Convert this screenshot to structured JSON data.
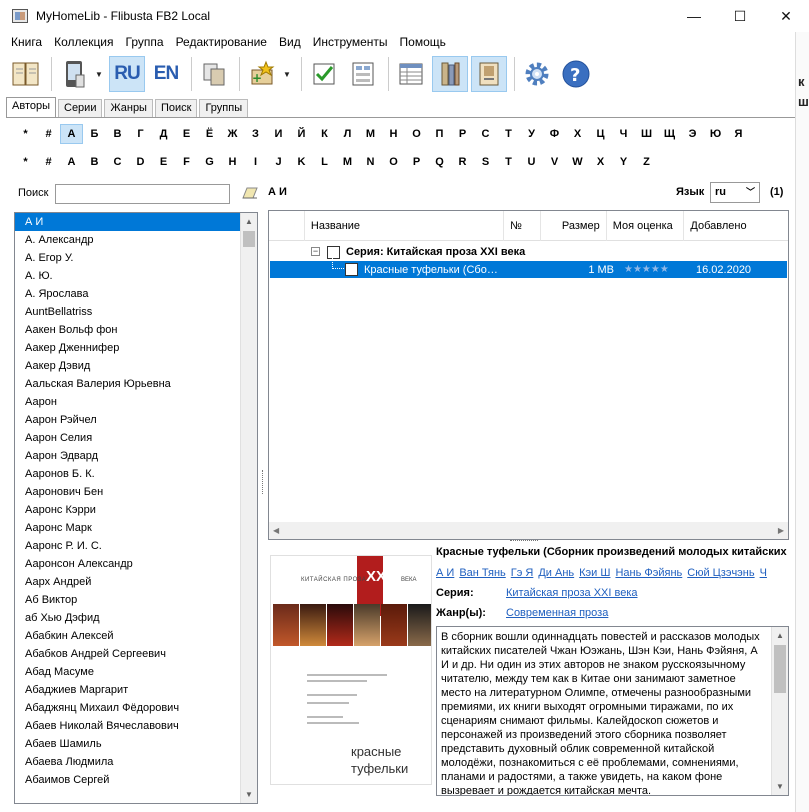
{
  "window": {
    "title": "MyHomeLib - Flibusta FB2 Local",
    "minimize": "—",
    "maximize": "☐",
    "close": "✕"
  },
  "menu": [
    "Книга",
    "Коллекция",
    "Группа",
    "Редактирование",
    "Вид",
    "Инструменты",
    "Помощь"
  ],
  "toolbar": {
    "lang_ru": "RU",
    "lang_en": "EN"
  },
  "tabs": [
    "Авторы",
    "Серии",
    "Жанры",
    "Поиск",
    "Группы"
  ],
  "alphabet_cyr": [
    "*",
    "#",
    "А",
    "Б",
    "В",
    "Г",
    "Д",
    "Е",
    "Ё",
    "Ж",
    "З",
    "И",
    "Й",
    "К",
    "Л",
    "М",
    "Н",
    "О",
    "П",
    "Р",
    "С",
    "Т",
    "У",
    "Ф",
    "Х",
    "Ц",
    "Ч",
    "Ш",
    "Щ",
    "Э",
    "Ю",
    "Я"
  ],
  "alphabet_lat": [
    "*",
    "#",
    "A",
    "B",
    "C",
    "D",
    "E",
    "F",
    "G",
    "H",
    "I",
    "J",
    "K",
    "L",
    "M",
    "N",
    "O",
    "P",
    "Q",
    "R",
    "S",
    "T",
    "U",
    "V",
    "W",
    "X",
    "Y",
    "Z"
  ],
  "search": {
    "label": "Поиск",
    "value": ""
  },
  "authors": [
    "А И",
    "А. Александр",
    "А. Егор У.",
    "А. Ю.",
    "А. Ярослава",
    "AuntBellatriss",
    "Аакен Вольф фон",
    "Аакер Дженнифер",
    "Аакер Дэвид",
    "Аальская Валерия Юрьевна",
    "Аарон",
    "Аарон Рэйчел",
    "Аарон Селия",
    "Аарон Эдвард",
    "Ааронов Б. К.",
    "Ааронович Бен",
    "Ааронс Кэрри",
    "Ааронс Марк",
    "Ааронс Р. И. С.",
    "Ааронсон Александр",
    "Аарх Андрей",
    "Аб Виктор",
    "аб Хью Дэфид",
    "Абабкин Алексей",
    "Абабков Андрей Сергеевич",
    "Абад Масуме",
    "Абаджиев Маргарит",
    "Абаджянц Михаил Фёдорович",
    "Абаев Николай Вячеславович",
    "Абаев Шамиль",
    "Абаева Людмила",
    "Абаимов Сергей"
  ],
  "selected_author": "А И",
  "language": {
    "label": "Язык",
    "value": "ru",
    "count": "(1)"
  },
  "books_columns": [
    "Название",
    "№",
    "Размер",
    "Моя оценка",
    "Добавлено"
  ],
  "series_row": "Серия: Китайская проза XXI века",
  "book_row": {
    "title": "Красные туфельки (Сбо…",
    "size": "1 MB",
    "rating": "★★★★★",
    "added": "16.02.2020"
  },
  "cover": {
    "series": "КИТАЙСКАЯ  ПРОЗА",
    "xxi": "XXI",
    "veka": "ВЕКА",
    "title1": "красные",
    "title2": "туфельки"
  },
  "info": {
    "title": "Красные туфельки (Сборник произведений молодых китайских писателей)",
    "authors": [
      "А И",
      "Ван Тянь",
      "Гэ Я",
      "Ди Ань",
      "Кэи Ш",
      "Нань Фэйянь",
      "Сюй Цзэчэнь",
      "Ч"
    ],
    "series_label": "Серия:",
    "series_value": "Китайская проза XXI века",
    "genre_label": "Жанр(ы):",
    "genre_value": "Современная проза",
    "annotation": "В сборник вошли одиннадцать повестей и рассказов молодых китайских писателей Чжан Юэжань, Шэн Кэи, Нань Фэйяня, А И и др. Ни один из этих авторов не знаком русскоязычному читателю, между тем как в Китае они занимают заметное место на литературном Олимпе, отмечены разнообразными премиями, их книги выходят огромными тиражами, по их сценариям снимают фильмы. Калейдоскоп сюжетов и персонажей из произведений этого сборника позволяет представить духовный облик современной китайской молодёжи, познакомиться с её проблемами, сомнениями, планами и радостями, а также увидеть, на каком фоне вызревает и рождается китайская мечта."
  }
}
